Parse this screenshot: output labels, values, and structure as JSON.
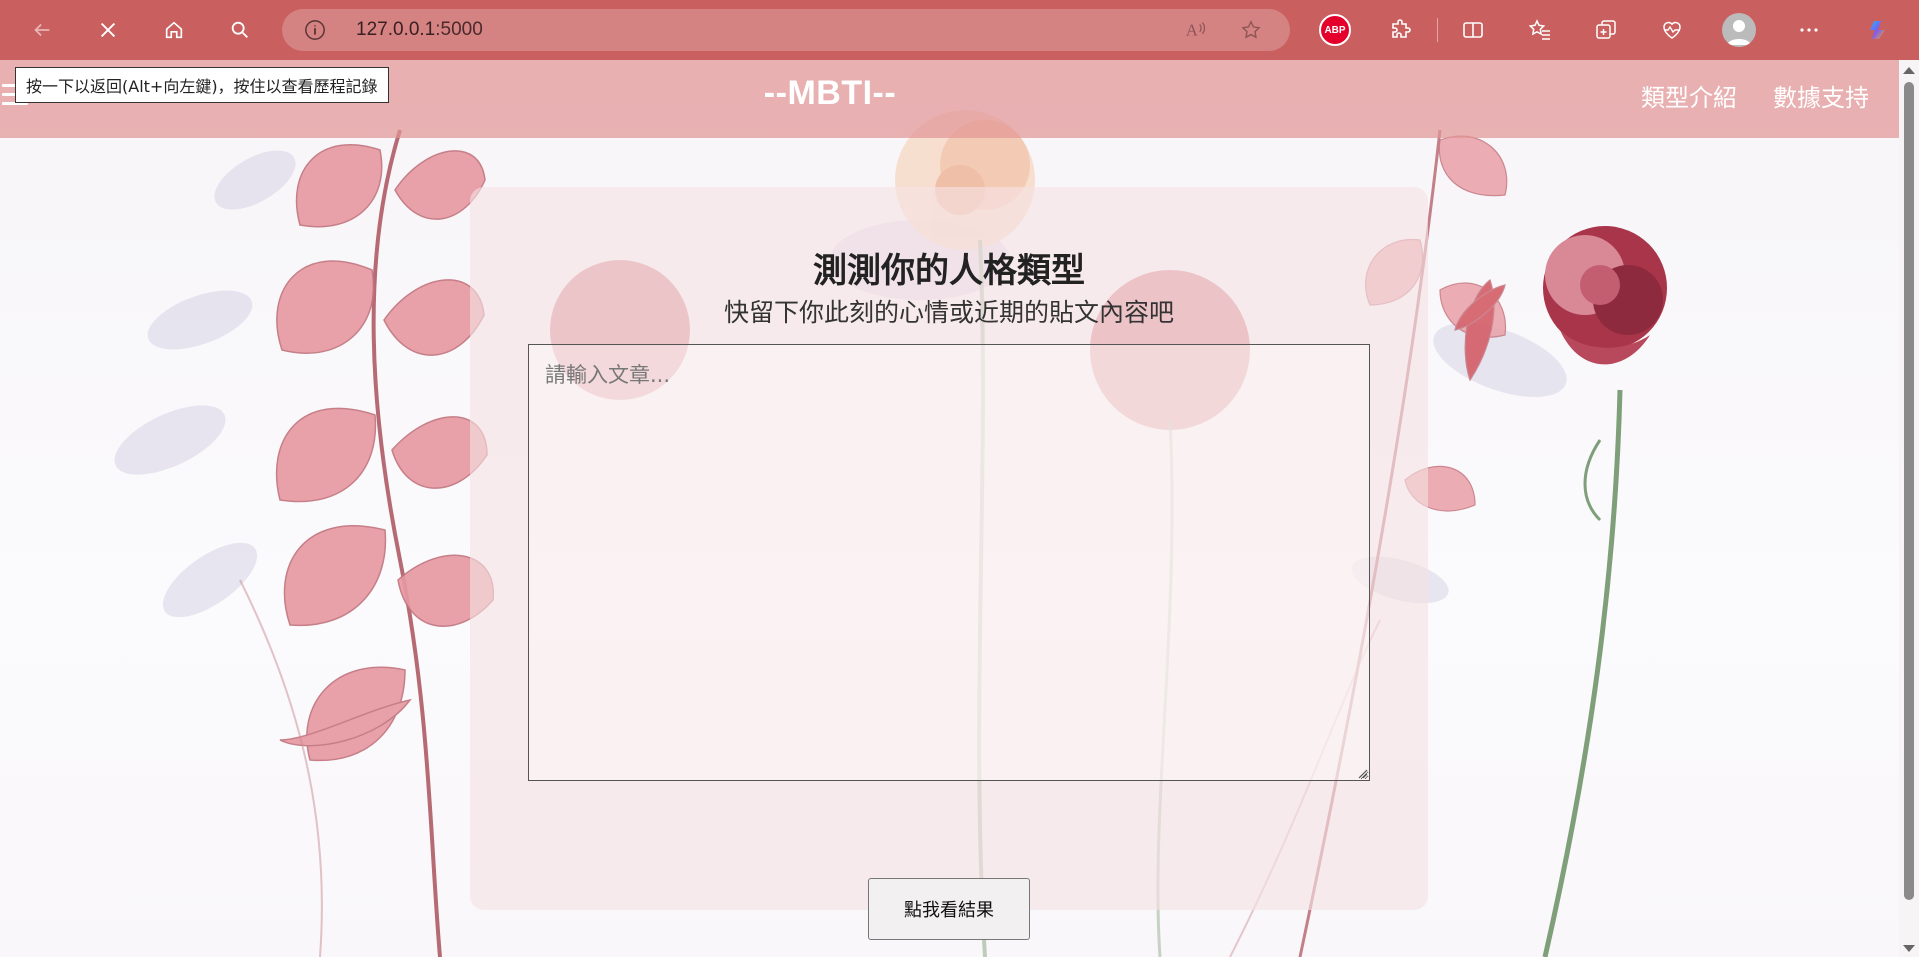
{
  "browser": {
    "url_host": "127.0.0.1",
    "url_port": ":5000",
    "back_tooltip": "按一下以返回(Alt+向左鍵)，按住以查看歷程記錄",
    "abp_label": "ABP",
    "icons": {
      "back": "back-arrow-icon",
      "stop": "close-icon",
      "home": "home-icon",
      "search": "search-icon",
      "info": "info-icon",
      "read_aloud": "read-aloud-icon",
      "favorite": "star-icon",
      "extensions": "puzzle-icon",
      "split": "split-screen-icon",
      "favorites_list": "favorites-icon",
      "collections": "collections-icon",
      "health": "heart-pulse-icon",
      "profile": "avatar",
      "more": "more-icon",
      "copilot": "copilot-icon"
    },
    "chrome_color": "#c95f5f"
  },
  "site": {
    "title": "--MBTI--",
    "nav": [
      "類型介紹",
      "數據支持"
    ],
    "header_color": "#e29696"
  },
  "main": {
    "heading": "測測你的人格類型",
    "subheading": "快留下你此刻的心情或近期的貼文內容吧",
    "textarea_placeholder": "請輸入文章...",
    "textarea_value": "",
    "submit_label": "點我看結果"
  }
}
